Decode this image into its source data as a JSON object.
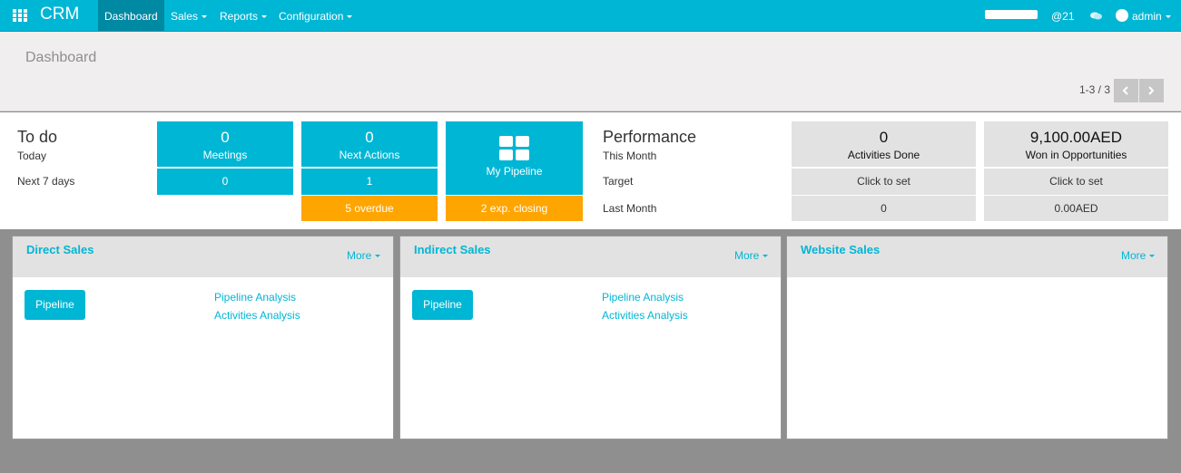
{
  "app": {
    "name": "CRM",
    "icon": "apps-grid-icon"
  },
  "nav": {
    "dashboard": "Dashboard",
    "sales": "Sales",
    "reports": "Reports",
    "configuration": "Configuration"
  },
  "systray": {
    "mentions": "@21",
    "chat_icon": "chat-bubbles-icon",
    "user": "admin"
  },
  "breadcrumb": "Dashboard",
  "pager": {
    "value": "1-3 / 3"
  },
  "todo": {
    "title": "To do",
    "today_label": "Today",
    "next7_label": "Next 7 days",
    "meetings": {
      "count": "0",
      "label": "Meetings",
      "next7": "0"
    },
    "next_actions": {
      "count": "0",
      "label": "Next Actions",
      "next7": "1",
      "overdue": "5 overdue"
    },
    "pipeline": {
      "icon": "pipeline-grid-icon",
      "label": "My Pipeline",
      "closing": "2 exp. closing"
    }
  },
  "performance": {
    "title": "Performance",
    "this_month_label": "This Month",
    "target_label": "Target",
    "last_month_label": "Last Month",
    "activities": {
      "value": "0",
      "label": "Activities Done",
      "target": "Click to set",
      "last_month": "0"
    },
    "won": {
      "value": "9,100.00AED",
      "label": "Won in Opportunities",
      "target": "Click to set",
      "last_month": "0.00AED"
    }
  },
  "teams": [
    {
      "title": "Direct Sales",
      "more": "More",
      "pipeline": "Pipeline",
      "links": [
        "Pipeline Analysis",
        "Activities Analysis"
      ]
    },
    {
      "title": "Indirect Sales",
      "more": "More",
      "pipeline": "Pipeline",
      "links": [
        "Pipeline Analysis",
        "Activities Analysis"
      ]
    },
    {
      "title": "Website Sales",
      "more": "More"
    }
  ],
  "colors": {
    "primary": "#00b6d5",
    "nav_active": "#0089a3",
    "warning": "#ffa500",
    "neutral_tile": "#e2e2e2",
    "background": "#8f8f8f"
  }
}
